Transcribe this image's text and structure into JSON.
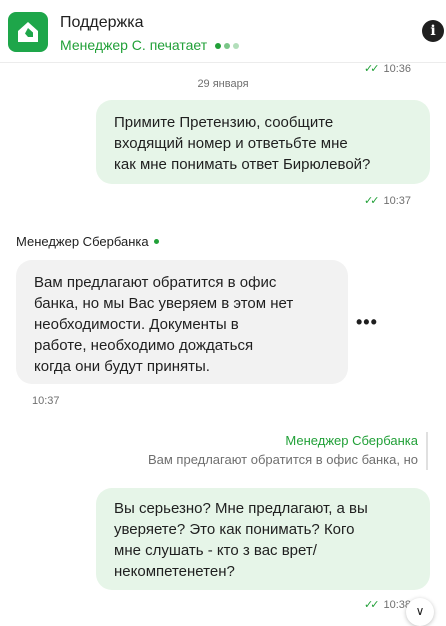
{
  "header": {
    "title": "Поддержка",
    "typing": "Менеджер С. печатает",
    "info_icon": "i"
  },
  "chat": {
    "date": "29 января",
    "first_time": "10:36",
    "messages": [
      {
        "direction": "out",
        "text": "Примите Претензию, сообщите\nвходящий номер и ответьбте мне\nкак мне понимать ответ Бирюлевой?",
        "time": "10:37",
        "status": "read"
      },
      {
        "direction": "in",
        "sender": "Менеджер Сбербанка",
        "text": "Вам предлагают обратится в офис\nбанка, но мы Вас уверяем в этом нет\nнеобходимости. Документы в\nработе, необходимо дождаться\nкогда они будут приняты.",
        "time": "10:37"
      },
      {
        "direction": "out",
        "quote_name": "Менеджер Сбербанка",
        "quote_text": "Вам предлагают обратится в офис банка, но",
        "text": "Вы серьезно? Мне предлагают, а вы\nуверяете? Это как понимать? Кого\nмне слушать - кто з вас врет/\nнекомпетенетен?",
        "time": "10:38",
        "status": "read"
      }
    ],
    "more_icon": "•••",
    "check_icon": "✓✓",
    "scroll_icon": "∨"
  },
  "colors": {
    "accent": "#21a038",
    "outgoing_bubble": "#e6f5e8",
    "incoming_bubble": "#f2f2f2"
  }
}
